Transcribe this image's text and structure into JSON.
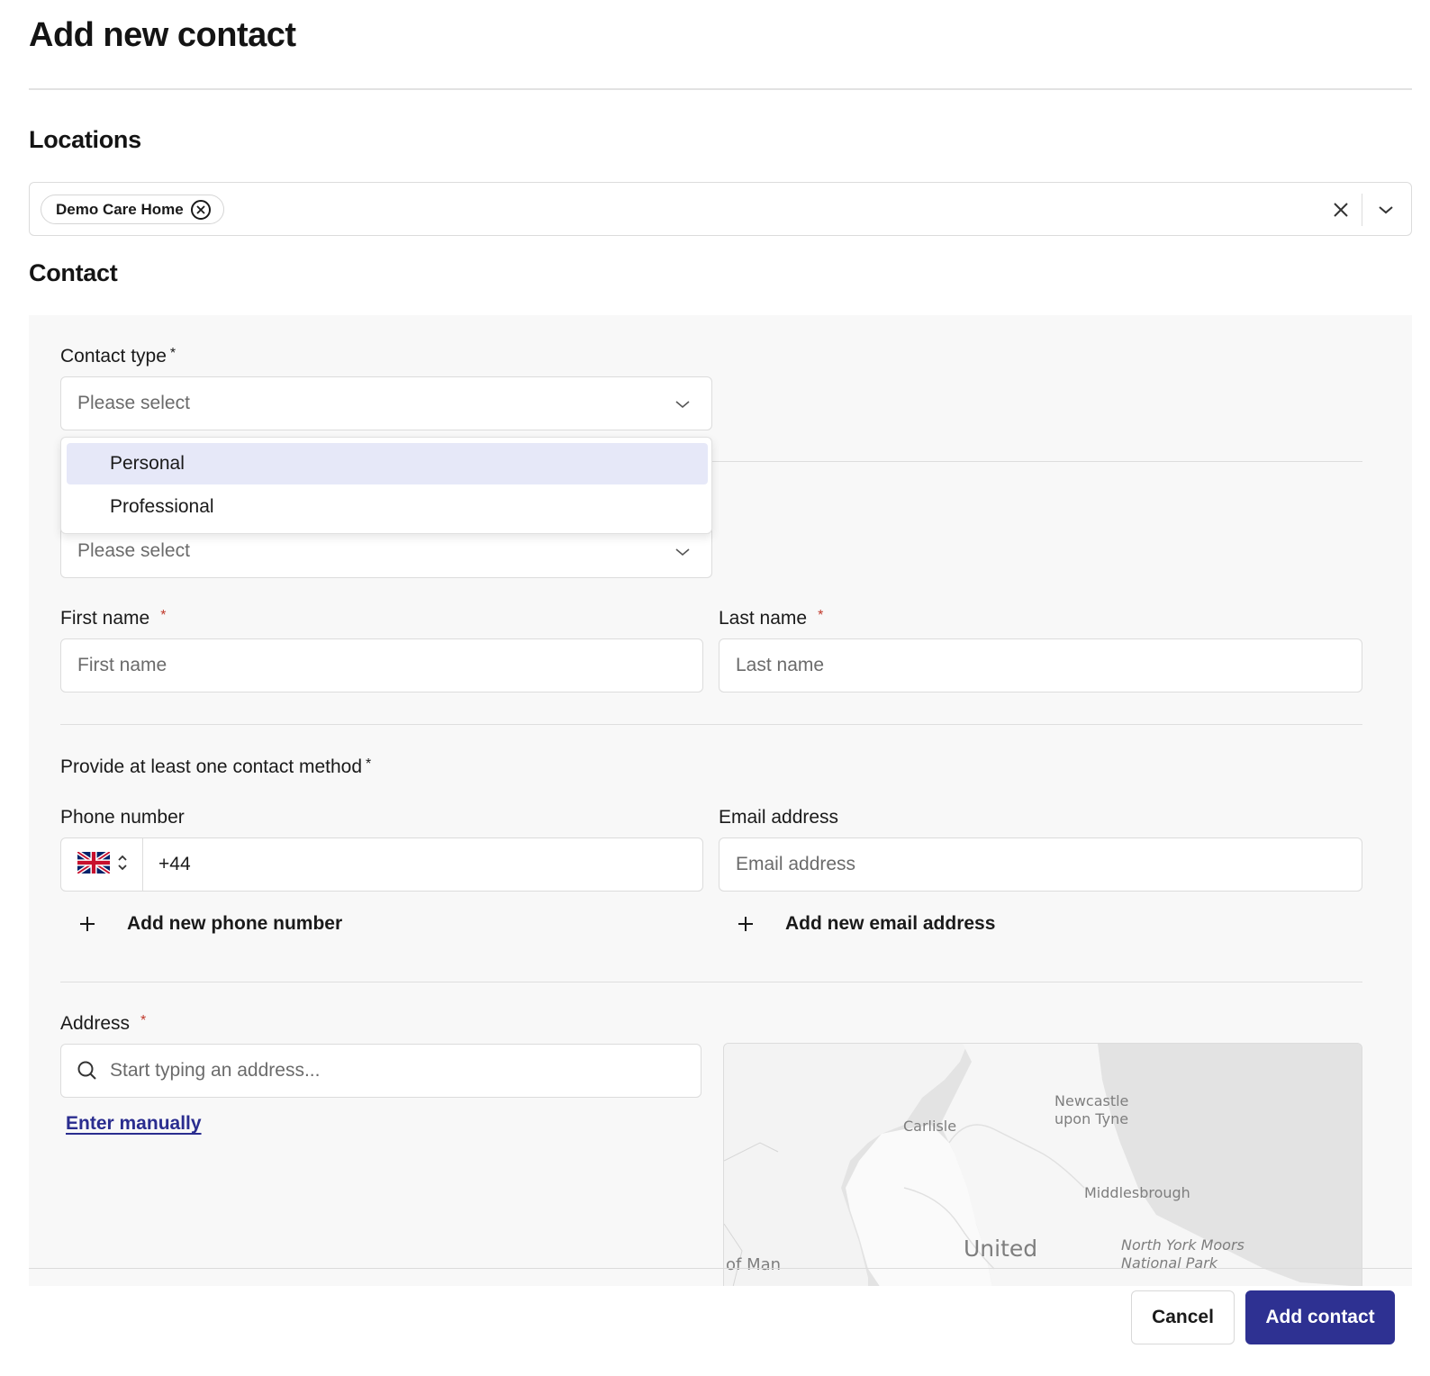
{
  "header": {
    "title": "Add new contact"
  },
  "locations": {
    "heading": "Locations",
    "selected_chip": "Demo Care Home"
  },
  "contact": {
    "heading": "Contact",
    "contact_type": {
      "label": "Contact type",
      "required_mark": "*",
      "placeholder": "Please select",
      "options": [
        {
          "label": "Personal",
          "highlighted": true
        },
        {
          "label": "Professional",
          "highlighted": false
        }
      ]
    },
    "second_select": {
      "placeholder": "Please select"
    },
    "first_name": {
      "label": "First name",
      "required_mark": "*",
      "placeholder": "First name"
    },
    "last_name": {
      "label": "Last name",
      "required_mark": "*",
      "placeholder": "Last name"
    },
    "contact_method": {
      "label": "Provide at least one contact method",
      "required_mark": "*"
    },
    "phone": {
      "label": "Phone number",
      "country_icon": "uk-flag-icon",
      "value": "+44",
      "add_label": "Add new phone number"
    },
    "email": {
      "label": "Email address",
      "placeholder": "Email address",
      "add_label": "Add new email address"
    },
    "address": {
      "label": "Address",
      "required_mark": "*",
      "placeholder": "Start typing an address...",
      "enter_manually": "Enter manually",
      "map_labels": {
        "newcastle": "Newcastle\nupon Tyne",
        "carlisle": "Carlisle",
        "middlesbrough": "Middlesbrough",
        "north_york_moors": "North York Moors\nNational Park",
        "united": "United",
        "isle_of_man": "of Man"
      }
    }
  },
  "footer": {
    "cancel_label": "Cancel",
    "submit_label": "Add contact"
  },
  "colors": {
    "primary": "#2e3192",
    "highlight": "#e6e8f8",
    "panel_bg": "#f8f8f8",
    "required": "#c0392b"
  }
}
